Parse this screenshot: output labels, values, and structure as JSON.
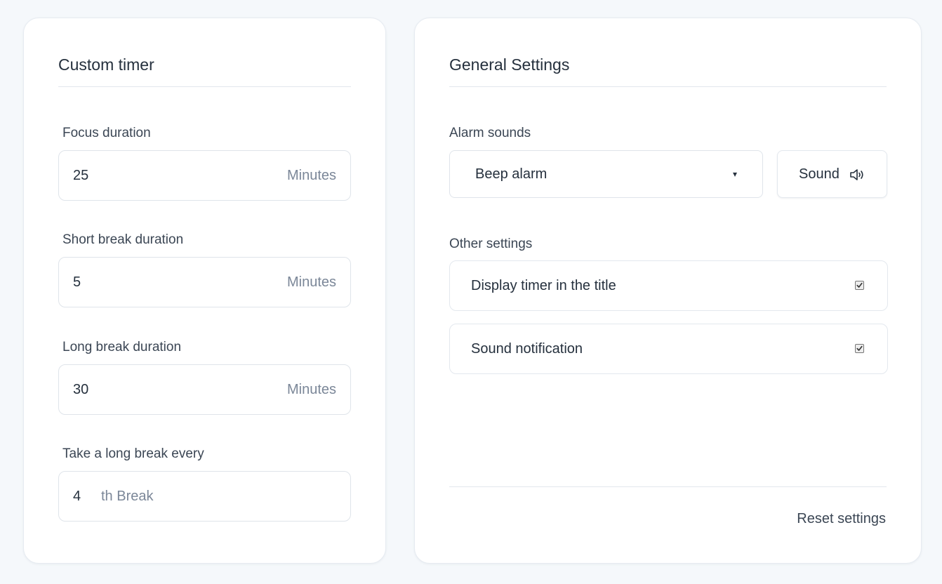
{
  "custom_timer": {
    "title": "Custom timer",
    "focus": {
      "label": "Focus duration",
      "value": "25",
      "unit": "Minutes"
    },
    "short_break": {
      "label": "Short break duration",
      "value": "5",
      "unit": "Minutes"
    },
    "long_break": {
      "label": "Long break duration",
      "value": "30",
      "unit": "Minutes"
    },
    "long_break_every": {
      "label": "Take a long break every",
      "value": "4",
      "unit": "th Break"
    }
  },
  "general_settings": {
    "title": "General Settings",
    "alarm": {
      "label": "Alarm sounds",
      "selected": "Beep alarm",
      "caret": "▾",
      "sound_button_label": "Sound",
      "sound_icon": "speaker-icon"
    },
    "other": {
      "label": "Other settings",
      "display_timer_in_title": {
        "label": "Display timer in the title",
        "checked": true
      },
      "sound_notification": {
        "label": "Sound notification",
        "checked": true
      }
    },
    "reset_label": "Reset settings"
  }
}
